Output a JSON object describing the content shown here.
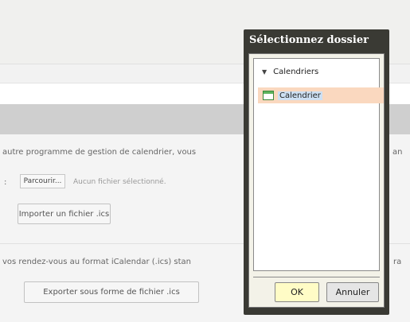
{
  "settings": {
    "import_description": "autre programme de gestion de calendrier, vous",
    "import_description_right": "an",
    "file_colon": ":",
    "browse_label": "Parcourir...",
    "no_file_label": "Aucun fichier sélectionné.",
    "import_button": "Importer un fichier .ics",
    "export_description": "vos rendez-vous au format iCalendar (.ics) stan",
    "export_description_right": "ra",
    "export_button": "Exporter sous forme de fichier .ics"
  },
  "dialog": {
    "title": "Sélectionnez dossier",
    "tree": {
      "root_label": "Calendriers",
      "root_expander": "▼",
      "items": [
        {
          "label": "Calendrier",
          "icon": "calendar-icon"
        }
      ]
    },
    "ok_label": "OK",
    "cancel_label": "Annuler"
  },
  "colors": {
    "dialog_frame": "#3a3a34",
    "selected_row": "#fad8bf",
    "ok_button": "#fffcc6"
  }
}
